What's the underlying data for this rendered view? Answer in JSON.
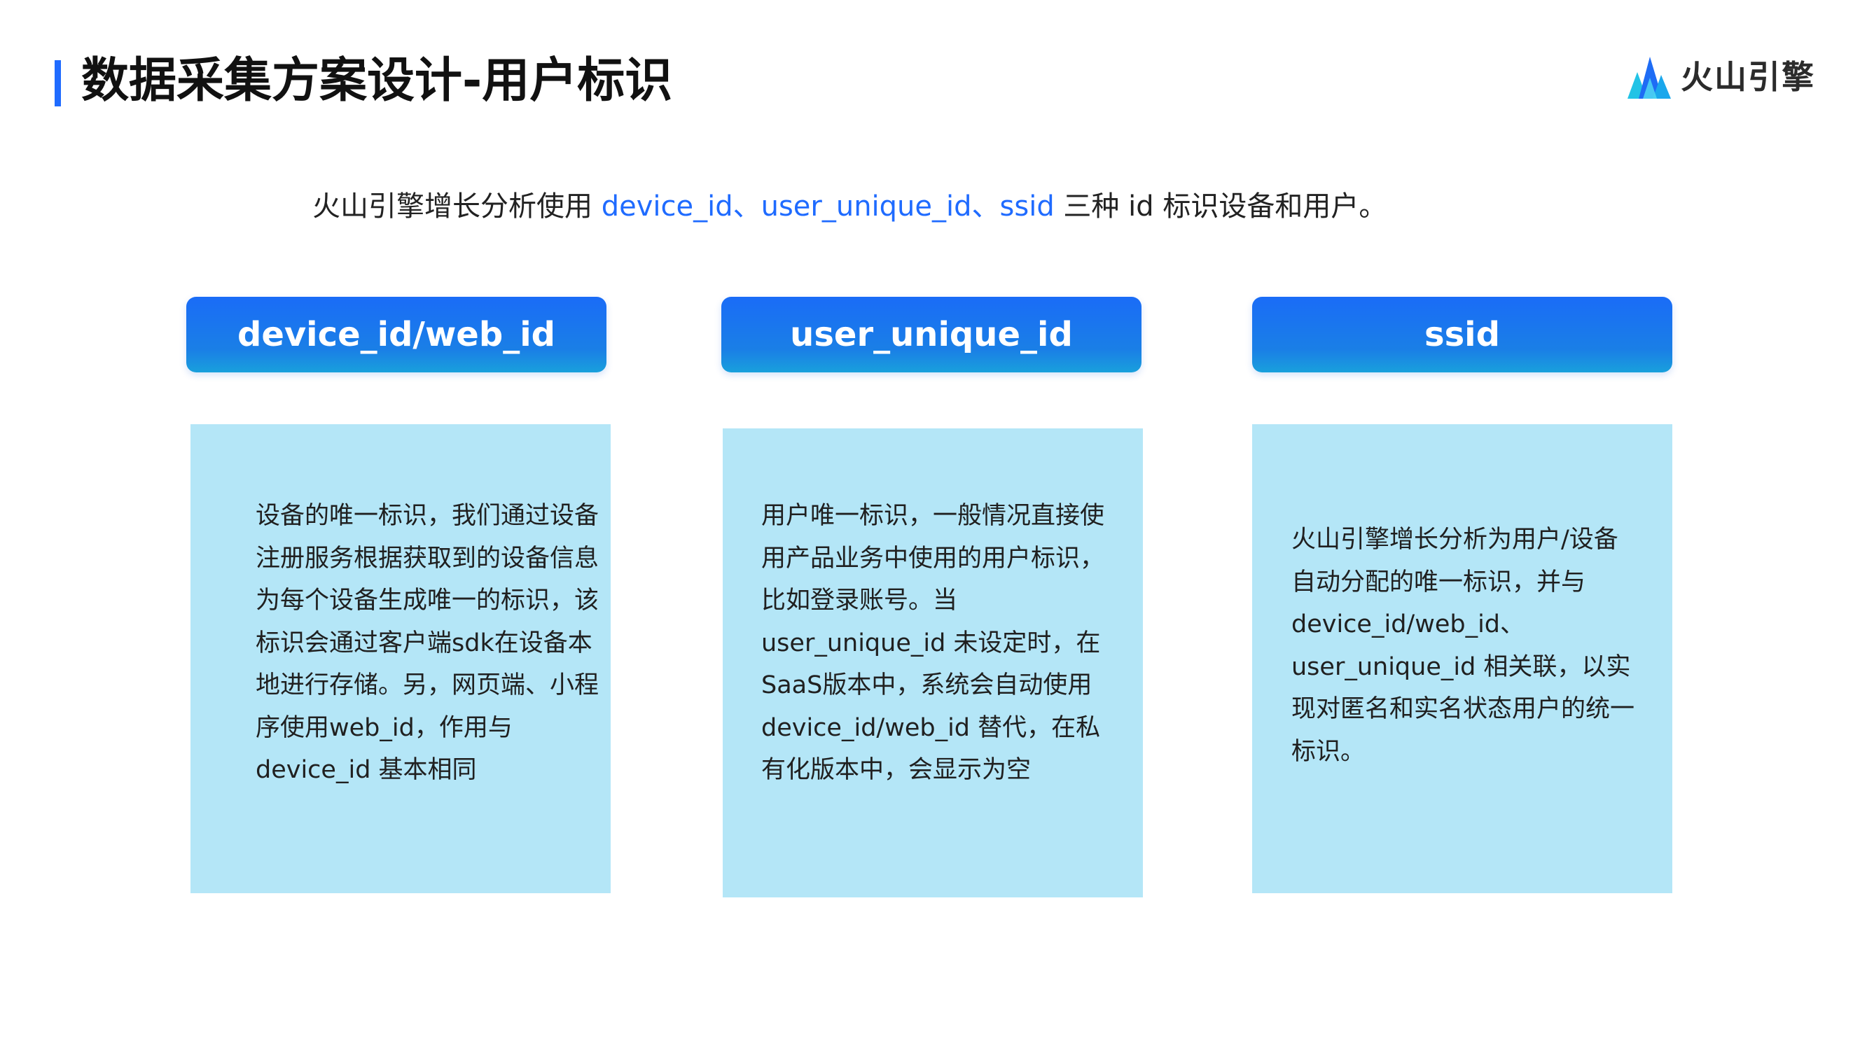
{
  "slide": {
    "title": "数据采集方案设计-用户标识",
    "logo_text": "火山引擎",
    "intro": {
      "prefix": "火山引擎增长分析使用 ",
      "highlight": "device_id、user_unique_id、ssid",
      "suffix": " 三种 id 标识设备和用户。"
    },
    "accent_color": "#1f6bff",
    "card_color": "#b4e6f7",
    "columns": [
      {
        "header": "device_id/web_id",
        "lines": [
          "设备的唯一标识，我们通过设备",
          "注册服务根据获取到的设备信息",
          "为每个设备生成唯一的标识，该",
          "标识会通过客户端sdk在设备本",
          "地进行存储。另，网页端、小程",
          "序使用web_id，作用与",
          "device_id 基本相同"
        ]
      },
      {
        "header": "user_unique_id",
        "lines": [
          "用户唯一标识，一般情况直接使",
          "用产品业务中使用的用户标识，",
          "比如登录账号。当",
          "user_unique_id 未设定时，在",
          "SaaS版本中，系统会自动使用",
          "device_id/web_id 替代，在私",
          "有化版本中，会显示为空"
        ]
      },
      {
        "header": "ssid",
        "lines": [
          "火山引擎增长分析为用户/设备",
          "自动分配的唯一标识，并与",
          "device_id/web_id、",
          "user_unique_id 相关联，以实",
          "现对匿名和实名状态用户的统一",
          "标识。"
        ]
      }
    ]
  }
}
